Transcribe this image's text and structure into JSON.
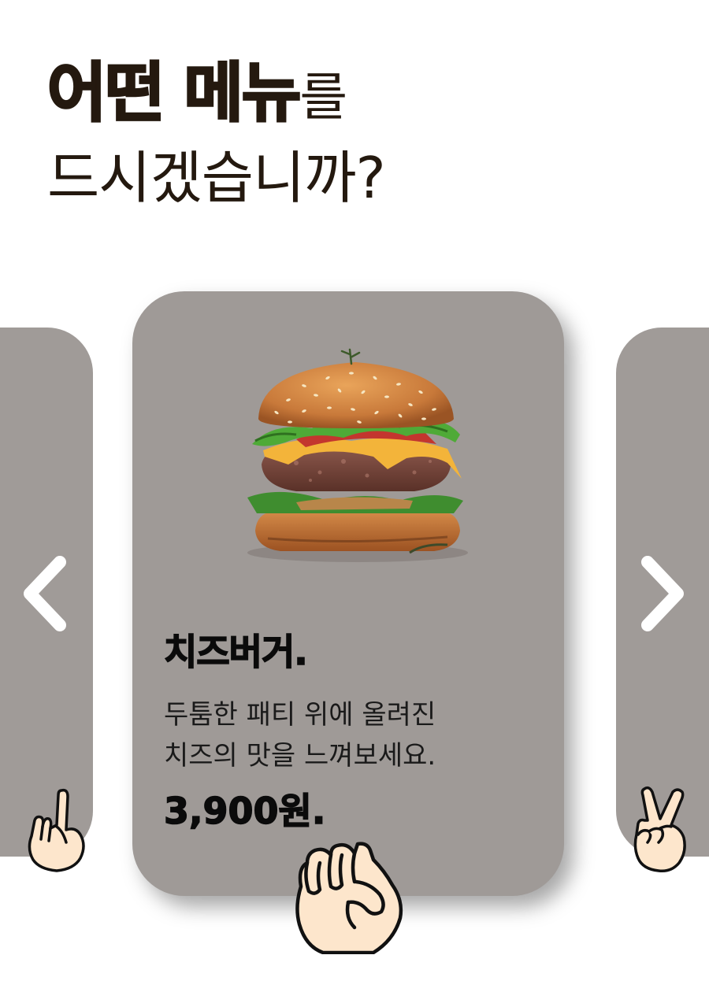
{
  "header": {
    "title_bold": "어떤 메뉴",
    "title_suffix": "를",
    "title_line2": "드시겠습니까?"
  },
  "carousel": {
    "prev_icon": "chevron-left-icon",
    "next_icon": "chevron-right-icon",
    "current_item": {
      "name": "치즈버거.",
      "description_lines": [
        "두툼한 패티 위에 올려진",
        "치즈의 맛을 느껴보세요."
      ],
      "price": "3,900원.",
      "image": "cheeseburger-image"
    }
  },
  "gestures": {
    "left": "one-finger-hand-icon",
    "center": "fist-hand-icon",
    "right": "peace-sign-hand-icon"
  },
  "colors": {
    "card_bg": "#9f9a97",
    "text_dark": "#24190f",
    "arrow": "#ffffff",
    "skin": "#fde6cc"
  }
}
